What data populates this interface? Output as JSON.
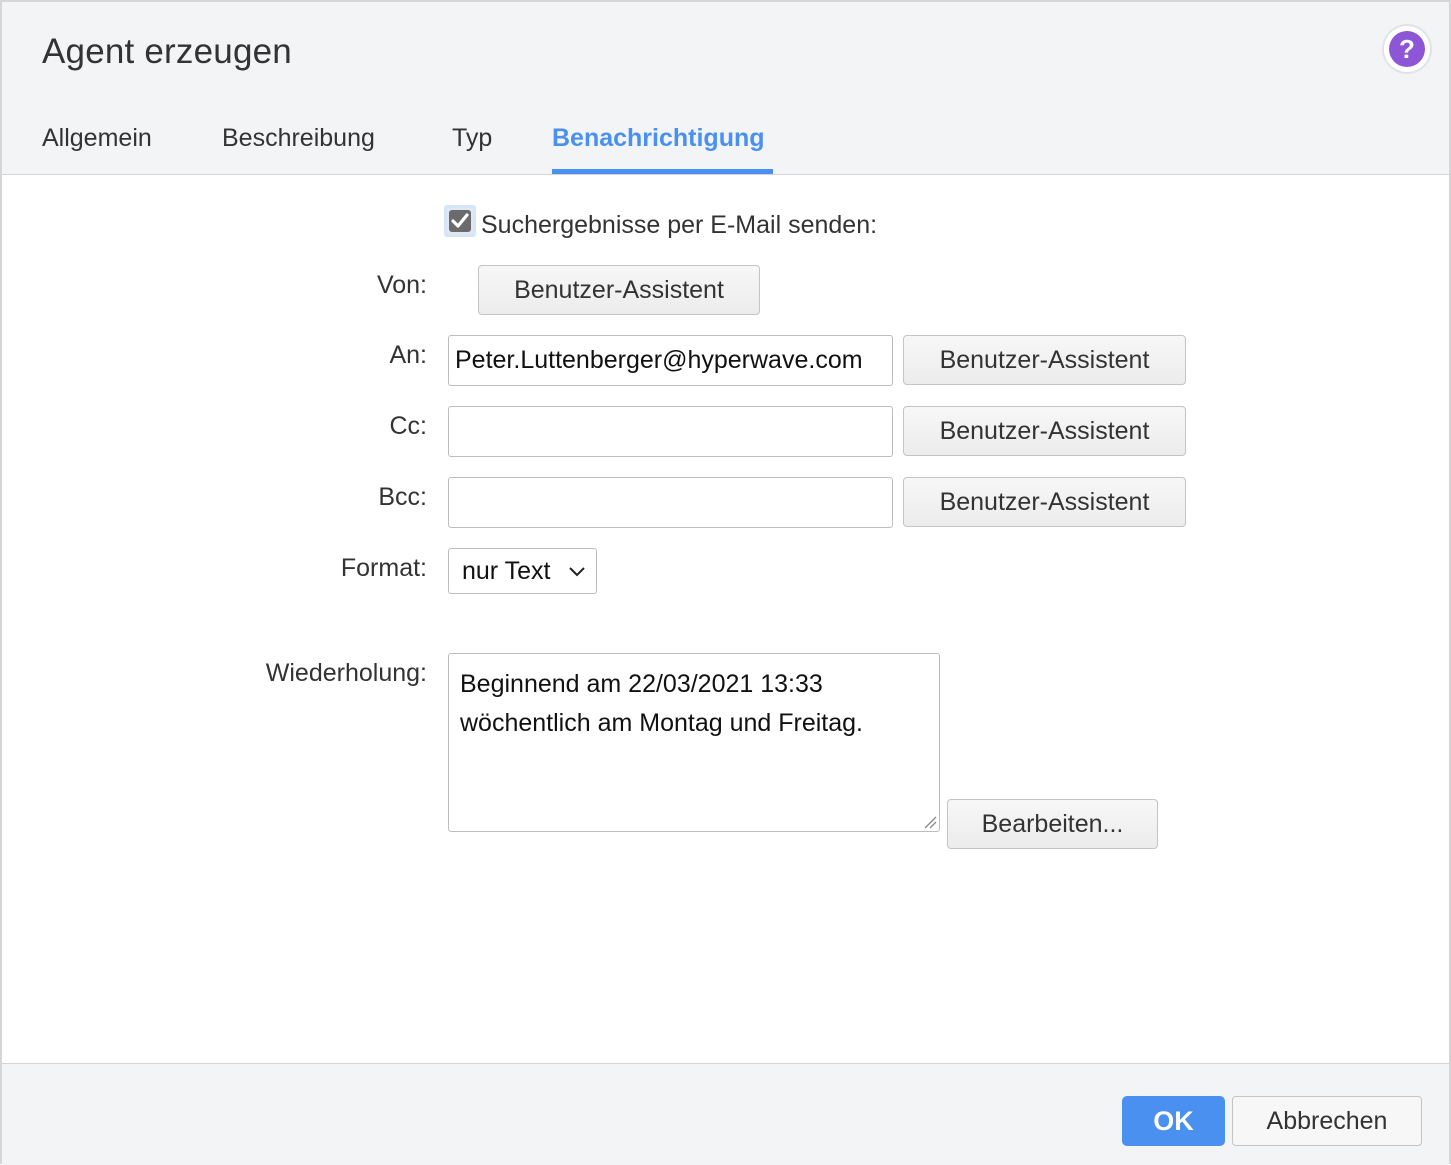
{
  "dialog": {
    "title": "Agent erzeugen",
    "help_icon": "question-mark-icon",
    "help_symbol": "?"
  },
  "tabs": [
    {
      "label": "Allgemein",
      "active": false
    },
    {
      "label": "Beschreibung",
      "active": false
    },
    {
      "label": "Typ",
      "active": false
    },
    {
      "label": "Benachrichtigung",
      "active": true
    }
  ],
  "form": {
    "send_email": {
      "label": "Suchergebnisse per E-Mail senden:",
      "checked": true
    },
    "von": {
      "label": "Von:",
      "button": "Benutzer-Assistent"
    },
    "an": {
      "label": "An:",
      "value": "Peter.Luttenberger@hyperwave.com",
      "button": "Benutzer-Assistent"
    },
    "cc": {
      "label": "Cc:",
      "value": "",
      "button": "Benutzer-Assistent"
    },
    "bcc": {
      "label": "Bcc:",
      "value": "",
      "button": "Benutzer-Assistent"
    },
    "format": {
      "label": "Format:",
      "selected": "nur Text"
    },
    "wiederholung": {
      "label": "Wiederholung:",
      "line1": "Beginnend am 22/03/2021 13:33",
      "line2": "wöchentlich am Montag und Freitag.",
      "button": "Bearbeiten..."
    }
  },
  "footer": {
    "ok_label": "OK",
    "cancel_label": "Abbrechen"
  },
  "colors": {
    "accent": "#4a90f0",
    "help": "#8c56d6",
    "header_bg": "#f3f4f6"
  }
}
